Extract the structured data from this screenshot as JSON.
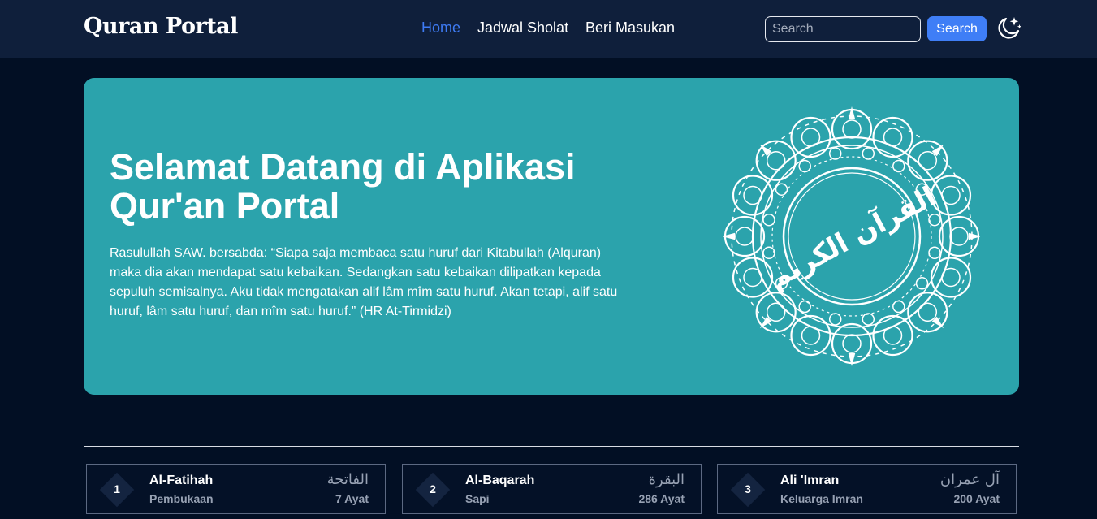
{
  "nav": {
    "brand": "Quran Portal",
    "links": [
      {
        "label": "Home",
        "active": true
      },
      {
        "label": "Jadwal Sholat",
        "active": false
      },
      {
        "label": "Beri Masukan",
        "active": false
      }
    ],
    "search_placeholder": "Search",
    "search_button": "Search",
    "theme_icon": "moon-stars-icon"
  },
  "hero": {
    "title": "Selamat Datang di Aplikasi Qur'an Portal",
    "quote": "Rasulullah SAW. bersabda: “Siapa saja membaca satu huruf dari Kitabullah (Alquran) maka dia akan mendapat satu kebaikan. Sedangkan satu kebaikan dilipatkan kepada sepuluh semisalnya. Aku tidak mengatakan alif lâm mîm satu huruf. Akan tetapi, alif satu huruf, lâm satu huruf, dan mîm satu huruf.” (HR At-Tirmidzi)",
    "ornament_icon": "al-quran-calligraphy-ornament",
    "ornament_text": "القرآن الكريم"
  },
  "surahs": [
    {
      "number": "1",
      "name": "Al-Fatihah",
      "meaning": "Pembukaan",
      "arabic": "الفاتحة",
      "ayat": "7 Ayat"
    },
    {
      "number": "2",
      "name": "Al-Baqarah",
      "meaning": "Sapi",
      "arabic": "البقرة",
      "ayat": "286 Ayat"
    },
    {
      "number": "3",
      "name": "Ali 'Imran",
      "meaning": "Keluarga Imran",
      "arabic": "آل عمران",
      "ayat": "200 Ayat"
    }
  ],
  "colors": {
    "background": "#020f24",
    "navbar": "#0f1f3b",
    "hero": "#2ba3ac",
    "accent": "#3f7ef6",
    "card_border": "#5c6982",
    "muted_text": "#97a1b3"
  }
}
